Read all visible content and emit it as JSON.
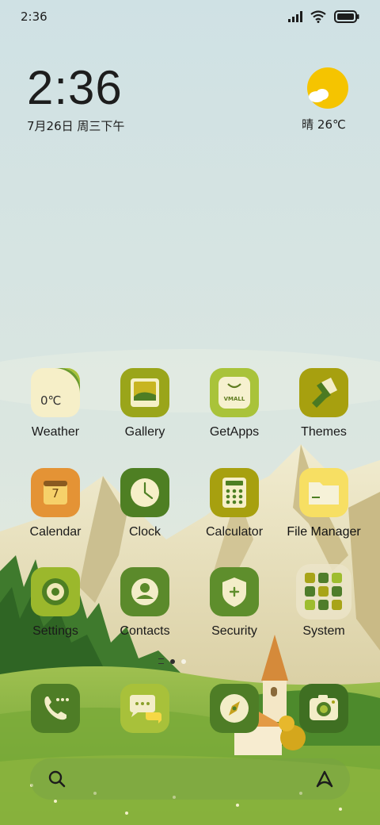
{
  "status_bar": {
    "time": "2:36",
    "icons": [
      "signal-icon",
      "wifi-icon",
      "battery-icon"
    ]
  },
  "clock_widget": {
    "time": "2:36",
    "date": "7月26日 周三下午"
  },
  "weather_widget": {
    "icon": "sunny-icon",
    "label": "晴 26℃"
  },
  "apps": [
    {
      "label": "Weather",
      "icon": "weather-icon",
      "icon_text": "0℃"
    },
    {
      "label": "Gallery",
      "icon": "gallery-icon"
    },
    {
      "label": "GetApps",
      "icon": "getapps-icon",
      "icon_text": "VMALL"
    },
    {
      "label": "Themes",
      "icon": "themes-icon"
    },
    {
      "label": "Calendar",
      "icon": "calendar-icon",
      "icon_text": "7"
    },
    {
      "label": "Clock",
      "icon": "clock-icon"
    },
    {
      "label": "Calculator",
      "icon": "calculator-icon"
    },
    {
      "label": "File Manager",
      "icon": "folder-icon"
    },
    {
      "label": "Settings",
      "icon": "settings-icon"
    },
    {
      "label": "Contacts",
      "icon": "contacts-icon"
    },
    {
      "label": "Security",
      "icon": "security-icon"
    },
    {
      "label": "System",
      "icon": "system-folder-icon"
    }
  ],
  "dock": [
    {
      "icon": "phone-icon"
    },
    {
      "icon": "messages-icon"
    },
    {
      "icon": "browser-icon"
    },
    {
      "icon": "camera-icon"
    }
  ],
  "page_indicator": {
    "pages": 3,
    "current": 2
  },
  "search_bar": {
    "left_icon": "search-icon",
    "right_icon": "assistant-icon"
  },
  "colors": {
    "sky": "#cfe0e3",
    "icon_dark_green": "#4f7d2a",
    "icon_olive": "#a8a418",
    "icon_lime": "#9ebd2e",
    "icon_yellow": "#f7e26a"
  }
}
